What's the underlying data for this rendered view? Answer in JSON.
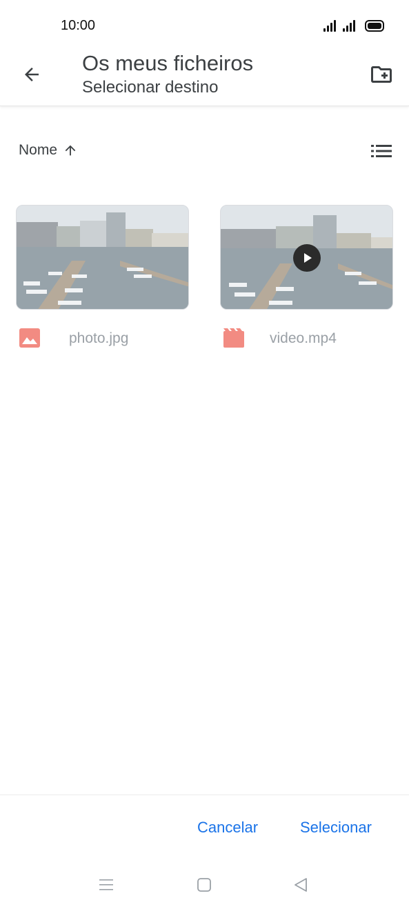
{
  "status_bar": {
    "time": "10:00",
    "icons": [
      "signal-1-icon",
      "signal-2-icon",
      "battery-icon"
    ]
  },
  "app_bar": {
    "back_icon": "arrow-left-icon",
    "title": "Os meus ficheiros",
    "subtitle": "Selecionar destino",
    "new_folder_icon": "create-new-folder-icon"
  },
  "sort": {
    "label": "Nome",
    "direction_icon": "arrow-up-icon",
    "view_icon": "list-view-icon"
  },
  "files": [
    {
      "name": "photo.jpg",
      "type_icon": "image-icon",
      "is_video": false
    },
    {
      "name": "video.mp4",
      "type_icon": "movie-icon",
      "is_video": true
    }
  ],
  "actions": {
    "cancel_label": "Cancelar",
    "select_label": "Selecionar"
  },
  "nav_bar": {
    "icons": [
      "menu-icon",
      "home-icon",
      "back-triangle-icon"
    ]
  },
  "colors": {
    "accent": "#1a73e8",
    "file_icon": "#f28b82",
    "muted_text": "#9aa0a6"
  }
}
